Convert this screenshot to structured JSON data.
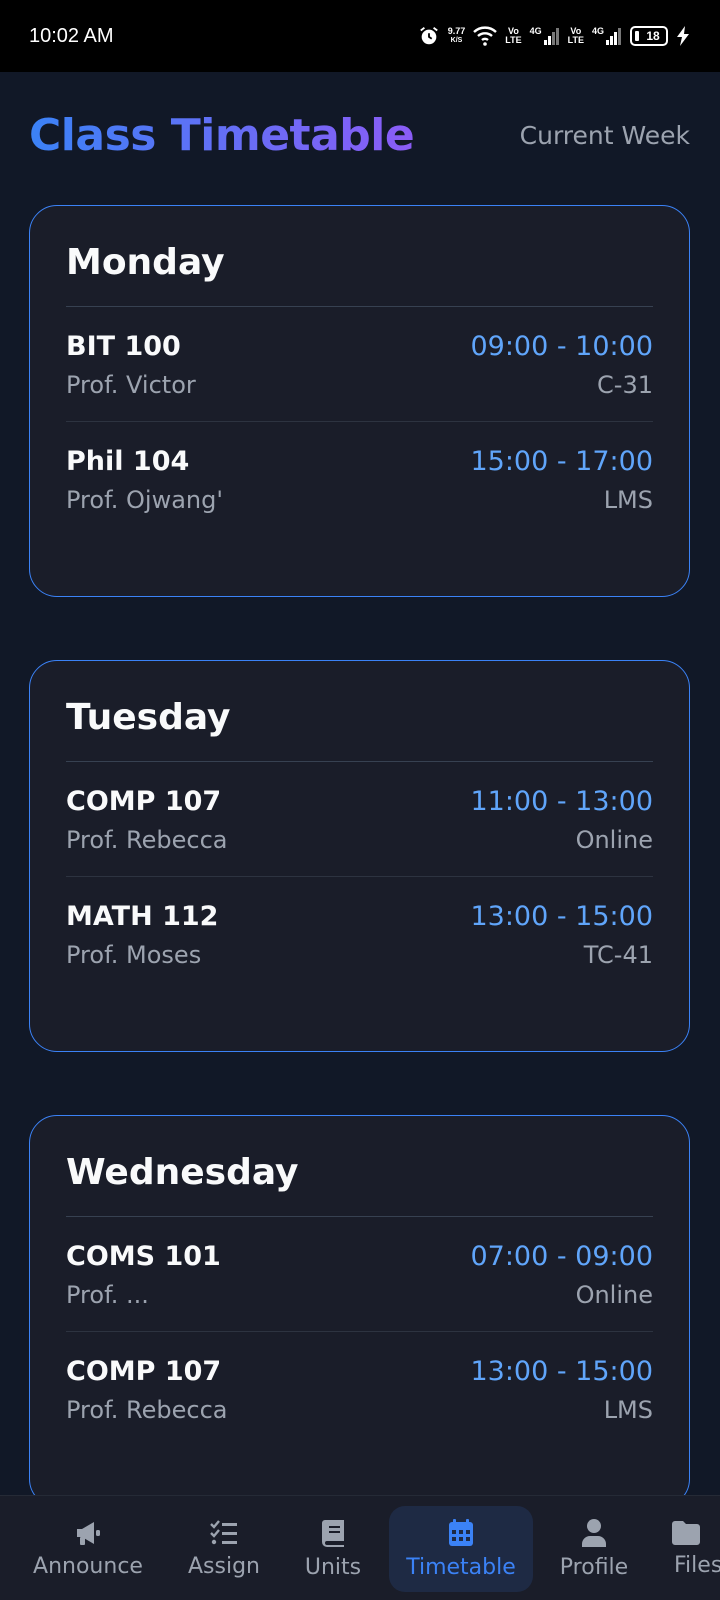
{
  "status_bar": {
    "time": "10:02 AM",
    "net_speed_value": "9.77",
    "net_speed_unit": "K/S",
    "volte1_top": "Vo",
    "volte1_bottom": "LTE",
    "volte2_top": "Vo",
    "volte2_bottom": "LTE",
    "network1": "4G",
    "network2": "4G",
    "battery": "18"
  },
  "header": {
    "title": "Class Timetable",
    "week_label": "Current Week"
  },
  "days": [
    {
      "name": "Monday",
      "classes": [
        {
          "code": "BIT 100",
          "professor": "Prof. Victor",
          "time": "09:00 - 10:00",
          "room": "C-31"
        },
        {
          "code": "Phil 104",
          "professor": "Prof. Ojwang'",
          "time": "15:00 - 17:00",
          "room": "LMS"
        }
      ]
    },
    {
      "name": "Tuesday",
      "classes": [
        {
          "code": "COMP 107",
          "professor": "Prof. Rebecca",
          "time": "11:00 - 13:00",
          "room": "Online"
        },
        {
          "code": "MATH 112",
          "professor": "Prof. Moses",
          "time": "13:00 - 15:00",
          "room": "TC-41"
        }
      ]
    },
    {
      "name": "Wednesday",
      "classes": [
        {
          "code": "COMS 101",
          "professor": "Prof. ...",
          "time": "07:00 - 09:00",
          "room": "Online"
        },
        {
          "code": "COMP 107",
          "professor": "Prof. Rebecca",
          "time": "13:00 - 15:00",
          "room": "LMS"
        }
      ]
    }
  ],
  "nav": {
    "items": [
      {
        "label": "Announce",
        "icon": "megaphone-icon"
      },
      {
        "label": "Assign",
        "icon": "checklist-icon"
      },
      {
        "label": "Units",
        "icon": "book-icon"
      },
      {
        "label": "Timetable",
        "icon": "calendar-icon",
        "active": true
      },
      {
        "label": "Profile",
        "icon": "user-icon"
      },
      {
        "label": "Files",
        "icon": "folder-icon"
      }
    ]
  },
  "colors": {
    "background": "#111827",
    "card": "#1a1d29",
    "accent": "#3b82f6",
    "time_text": "#60a5fa",
    "muted_text": "#9ca3af"
  }
}
